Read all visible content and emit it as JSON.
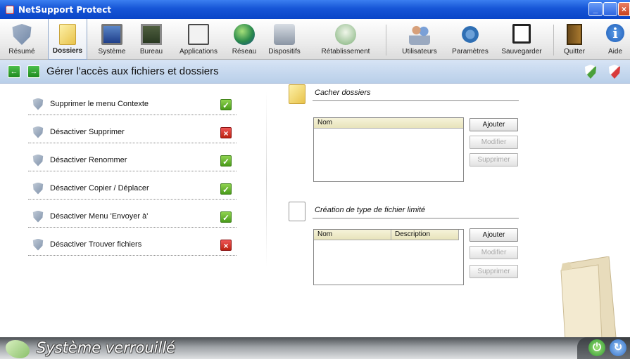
{
  "window": {
    "title": "NetSupport Protect"
  },
  "toolbar": {
    "items": [
      {
        "label": "Résumé",
        "icon": "shield-icon"
      },
      {
        "label": "Dossiers",
        "icon": "folder-icon"
      },
      {
        "label": "Système",
        "icon": "monitor-icon"
      },
      {
        "label": "Bureau",
        "icon": "desktop-icon"
      },
      {
        "label": "Applications",
        "icon": "window-icon"
      },
      {
        "label": "Réseau",
        "icon": "globe-icon"
      },
      {
        "label": "Dispositifs",
        "icon": "devices-icon"
      },
      {
        "label": "Rétablissement",
        "icon": "restore-icon"
      },
      {
        "label": "Utilisateurs",
        "icon": "users-icon"
      },
      {
        "label": "Paramètres",
        "icon": "gear-icon"
      },
      {
        "label": "Sauvegarder",
        "icon": "save-icon"
      },
      {
        "label": "Quitter",
        "icon": "exit-door-icon"
      },
      {
        "label": "Aide",
        "icon": "info-icon"
      }
    ],
    "active": "Dossiers"
  },
  "header": {
    "title": "Gérer l'accès aux fichiers et dossiers"
  },
  "options": [
    {
      "label": "Supprimer le menu Contexte",
      "checked": true
    },
    {
      "label": "Désactiver Supprimer",
      "checked": false
    },
    {
      "label": "Désactiver Renommer",
      "checked": true
    },
    {
      "label": "Désactiver Copier / Déplacer",
      "checked": true
    },
    {
      "label": "Désactiver Menu 'Envoyer à'",
      "checked": true
    },
    {
      "label": "Désactiver Trouver fichiers",
      "checked": false
    }
  ],
  "hide_folders": {
    "title": "Cacher dossiers",
    "columns": [
      "Nom"
    ],
    "buttons": {
      "add": "Ajouter",
      "edit": "Modifier",
      "delete": "Supprimer"
    }
  },
  "restricted_files": {
    "title": "Création de type de fichier limité",
    "columns": [
      "Nom",
      "Description"
    ],
    "buttons": {
      "add": "Ajouter",
      "edit": "Modifier",
      "delete": "Supprimer"
    }
  },
  "status": {
    "text": "Système verrouillé"
  },
  "colors": {
    "accent": "#1655d6",
    "header_bg": "#c9daef",
    "check_on": "#5aab24",
    "check_off": "#cc2222"
  }
}
